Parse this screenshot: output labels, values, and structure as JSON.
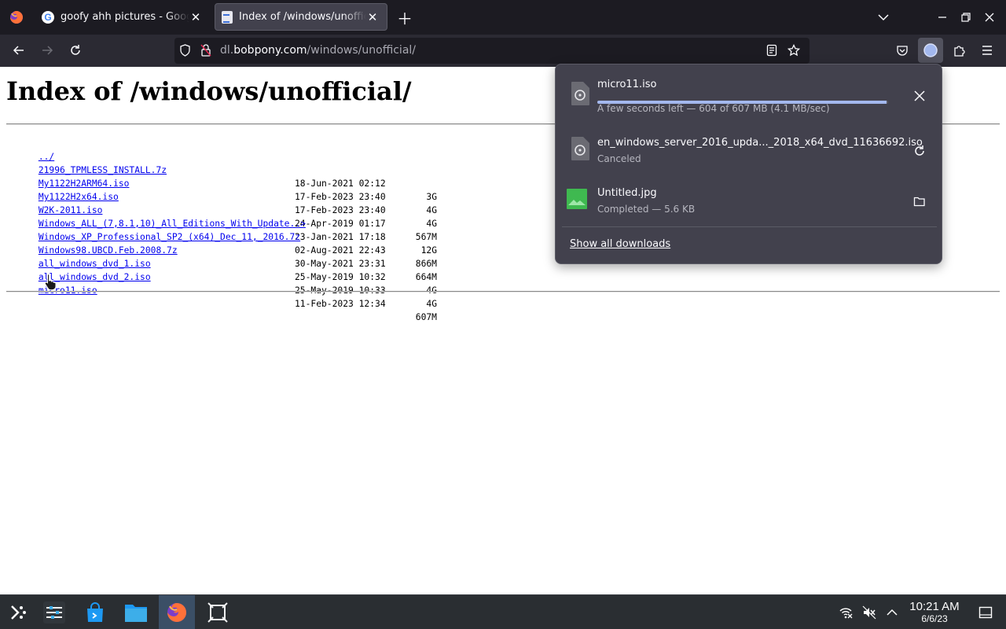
{
  "tabs": [
    {
      "title": "goofy ahh pictures - Google Search",
      "favicon": "google-favicon",
      "active": false
    },
    {
      "title": "Index of /windows/unofficial/",
      "favicon": "document-favicon",
      "active": true
    }
  ],
  "url": {
    "domain_prefix": "dl.",
    "domain": "bobpony.com",
    "path": "/windows/unofficial/"
  },
  "page": {
    "title": "Index of /windows/unofficial/",
    "parent_link": "../",
    "entries": [
      {
        "name": "21996_TPMLESS_INSTALL.7z",
        "date": "18-Jun-2021 02:12",
        "size": "3G"
      },
      {
        "name": "My1122H2ARM64.iso",
        "date": "17-Feb-2023 23:40",
        "size": "4G"
      },
      {
        "name": "My1122H2x64.iso",
        "date": "17-Feb-2023 23:40",
        "size": "4G"
      },
      {
        "name": "W2K-2011.iso",
        "date": "24-Apr-2019 01:17",
        "size": "567M"
      },
      {
        "name": "Windows_ALL_(7,8.1,10)_All_Editions_With_Update..>",
        "date": "23-Jan-2021 17:18",
        "size": "12G"
      },
      {
        "name": "Windows_XP_Professional_SP2_(x64)_Dec_11,_2016.7z",
        "date": "02-Aug-2021 22:43",
        "size": "866M"
      },
      {
        "name": "Windows98.UBCD.Feb.2008.7z",
        "date": "30-May-2021 23:31",
        "size": "664M"
      },
      {
        "name": "all_windows_dvd_1.iso",
        "date": "25-May-2019 10:32",
        "size": "4G"
      },
      {
        "name": "all_windows_dvd_2.iso",
        "date": "25-May-2019 10:33",
        "size": "4G"
      },
      {
        "name": "micro11.iso",
        "date": "11-Feb-2023 12:34",
        "size": "607M"
      }
    ]
  },
  "downloads": {
    "items": [
      {
        "name": "micro11.iso",
        "status": "A few seconds left — 604 of 607 MB (4.1 MB/sec)",
        "progress": 0.995,
        "icon": "disc-file-icon",
        "action": "cancel-icon"
      },
      {
        "name": "en_windows_server_2016_upda..._2018_x64_dvd_11636692.iso",
        "status": "Canceled",
        "icon": "disc-file-icon",
        "action": "retry-icon"
      },
      {
        "name": "Untitled.jpg",
        "status": "Completed — 5.6 KB",
        "icon": "image-file-icon",
        "action": "folder-icon"
      }
    ],
    "show_all": "Show all downloads"
  },
  "clock": {
    "time": "10:21 AM",
    "date": "6/6/23"
  },
  "colors": {
    "link": "#0000ee",
    "panel_bg": "#42414d",
    "chrome_bg": "#1c1b22",
    "progress": "#a3b8ee",
    "taskbar_active": "#3b4f66"
  }
}
